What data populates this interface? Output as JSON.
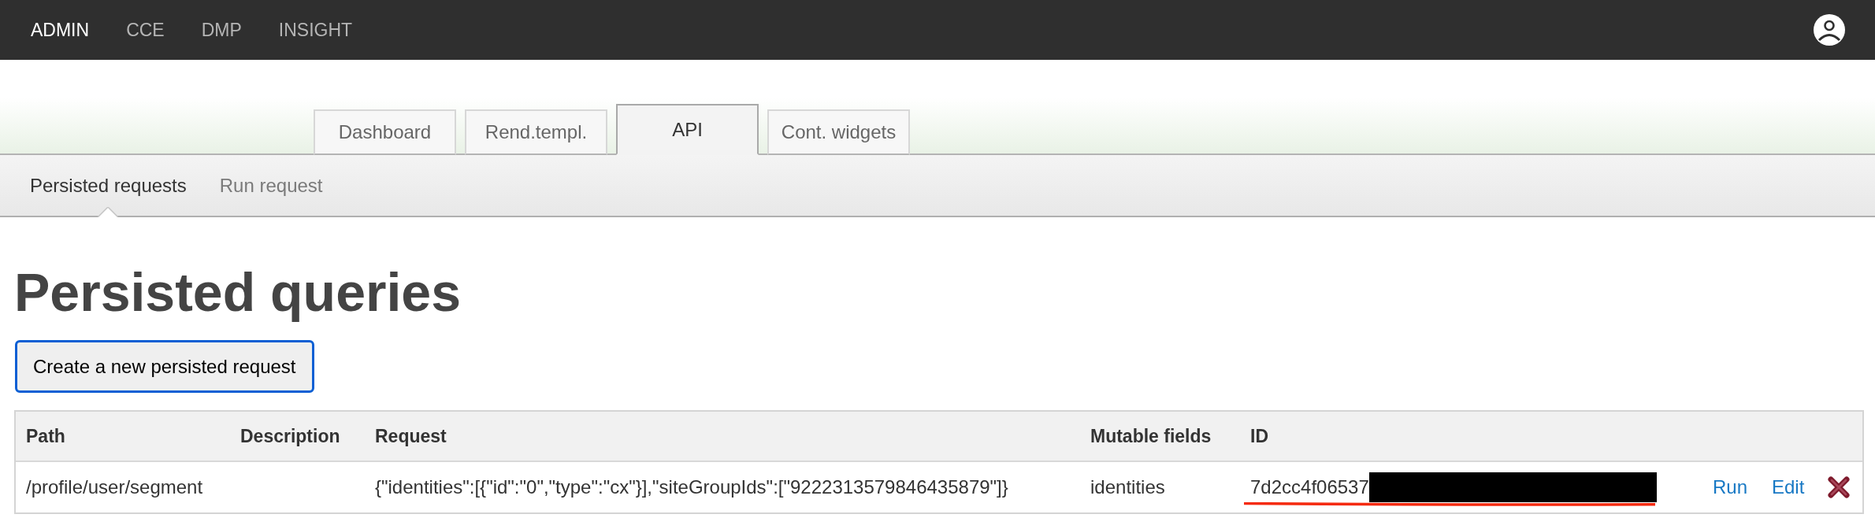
{
  "top_nav": {
    "items": [
      {
        "label": "ADMIN",
        "selected": true
      },
      {
        "label": "CCE",
        "selected": false
      },
      {
        "label": "DMP",
        "selected": false
      },
      {
        "label": "INSIGHT",
        "selected": false
      }
    ]
  },
  "tabs": [
    {
      "label": "Dashboard",
      "selected": false
    },
    {
      "label": "Rend.templ.",
      "selected": false
    },
    {
      "label": "API",
      "selected": true
    },
    {
      "label": "Cont. widgets",
      "selected": false
    }
  ],
  "sub_nav": [
    {
      "label": "Persisted requests",
      "selected": true
    },
    {
      "label": "Run request",
      "selected": false
    }
  ],
  "heading": "Persisted queries",
  "create_button": "Create a new persisted request",
  "table": {
    "columns": [
      "Path",
      "Description",
      "Request",
      "Mutable fields",
      "ID"
    ],
    "rows": [
      {
        "path": "/profile/user/segment",
        "request": "{\"identities\":[{\"id\":\"0\",\"type\":\"cx\"}],\"siteGroupIds\":[\"9222313579846435879\"]}",
        "mutable_fields": "identities",
        "id": {
          "text": "7d2cc4f06537",
          "redacted": true,
          "underlined": true
        },
        "actions": [
          "Run",
          "Edit"
        ]
      }
    ]
  }
}
